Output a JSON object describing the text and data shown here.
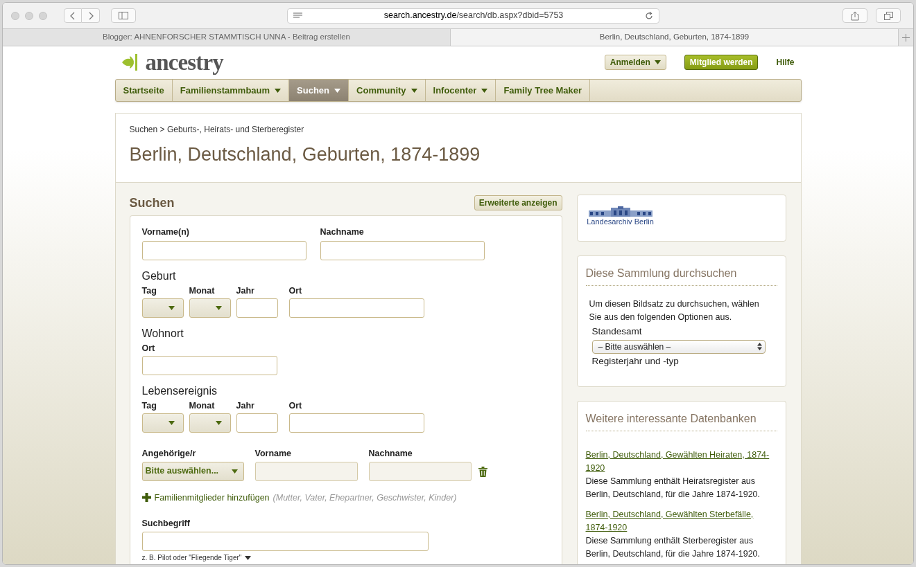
{
  "browser": {
    "url_host": "search.ancestry.de",
    "url_path": "/search/db.aspx?dbid=5753",
    "tabs": [
      {
        "title": "Blogger: AHNENFORSCHER STAMMTISCH UNNA - Beitrag erstellen",
        "selected": false
      },
      {
        "title": "Berlin, Deutschland, Geburten, 1874-1899",
        "selected": true
      }
    ]
  },
  "header": {
    "logo": "ancestry",
    "login": "Anmelden",
    "join": "Mitglied werden",
    "help": "Hilfe"
  },
  "nav": [
    {
      "label": "Startseite",
      "dropdown": false,
      "selected": false
    },
    {
      "label": "Familienstammbaum",
      "dropdown": true,
      "selected": false
    },
    {
      "label": "Suchen",
      "dropdown": true,
      "selected": true
    },
    {
      "label": "Community",
      "dropdown": true,
      "selected": false
    },
    {
      "label": "Infocenter",
      "dropdown": true,
      "selected": false
    },
    {
      "label": "Family Tree Maker",
      "dropdown": false,
      "selected": false
    }
  ],
  "breadcrumb": "Suchen > Geburts-, Heirats- und Sterberegister",
  "title": "Berlin, Deutschland, Geburten, 1874-1899",
  "search": {
    "heading": "Suchen",
    "advanced_button": "Erweiterte anzeigen",
    "names": [
      {
        "label": "Vorname(n)"
      },
      {
        "label": "Nachname"
      }
    ],
    "events": [
      {
        "title": "Geburt",
        "fields": [
          {
            "label": "Tag",
            "kind": "select"
          },
          {
            "label": "Monat",
            "kind": "select"
          },
          {
            "label": "Jahr",
            "kind": "year"
          },
          {
            "label": "Ort",
            "kind": "place"
          }
        ]
      },
      {
        "title": "Wohnort",
        "fields": [
          {
            "label": "Ort",
            "kind": "place"
          }
        ]
      },
      {
        "title": "Lebensereignis",
        "fields": [
          {
            "label": "Tag",
            "kind": "select"
          },
          {
            "label": "Monat",
            "kind": "select"
          },
          {
            "label": "Jahr",
            "kind": "year"
          },
          {
            "label": "Ort",
            "kind": "place"
          }
        ]
      }
    ],
    "relative": [
      {
        "label": "Angehörige/r",
        "kind": "select",
        "value": "Bitte auswählen..."
      },
      {
        "label": "Vorname",
        "kind": "text",
        "disabled": true
      },
      {
        "label": "Nachname",
        "kind": "text",
        "disabled": true
      }
    ],
    "add_family": {
      "label": "Familienmitglieder hinzufügen",
      "hint": "(Mutter, Vater, Ehepartner, Geschwister, Kinder)"
    },
    "keyword": {
      "label": "Suchbegriff",
      "hint": "z. B. Pilot oder \"Fliegende Tiger\""
    }
  },
  "archive_logo": "Landesarchiv Berlin",
  "browse": {
    "title": "Diese Sammlung durchsuchen",
    "intro": "Um diesen Bildsatz zu durchsuchen, wählen Sie aus den folgenden Optionen aus.",
    "fields": [
      {
        "label": "Standesamt",
        "kind": "select",
        "value": "– Bitte auswählen –"
      },
      {
        "label": "Registerjahr und -typ",
        "kind": "label"
      }
    ]
  },
  "related": {
    "title": "Weitere interessante Datenbanken",
    "items": [
      {
        "link": "Berlin, Deutschland, Gewählten Heiraten, 1874-1920",
        "description": "Diese Sammlung enthält Heiratsregister aus Berlin, Deutschland, für die Jahre 1874-1920."
      },
      {
        "link": "Berlin, Deutschland, Gewählten Sterbefälle, 1874-1920",
        "description": "Diese Sammlung enthält Sterberegister aus Berlin, Deutschland, für die Jahre 1874-1920."
      }
    ]
  }
}
